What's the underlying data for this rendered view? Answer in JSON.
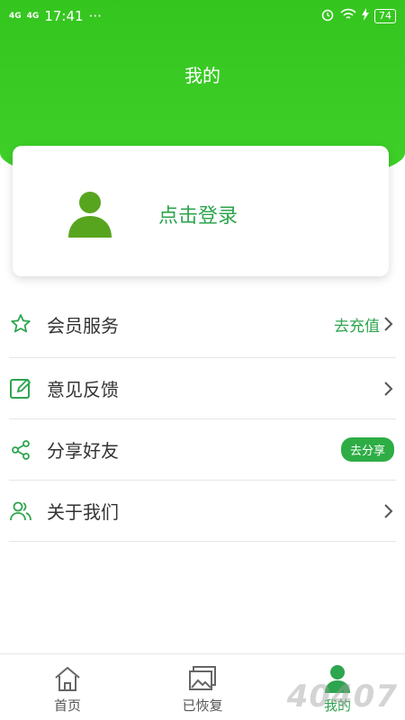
{
  "status_bar": {
    "signal1": "4G",
    "signal2": "4G",
    "time": "17:41",
    "more": "···",
    "battery": "74"
  },
  "header": {
    "title": "我的"
  },
  "login_card": {
    "login_text": "点击登录"
  },
  "menu": {
    "items": [
      {
        "label": "会员服务",
        "right_text": "去充值"
      },
      {
        "label": "意见反馈"
      },
      {
        "label": "分享好友",
        "badge": "去分享"
      },
      {
        "label": "关于我们"
      }
    ]
  },
  "tabbar": {
    "tabs": [
      {
        "label": "首页"
      },
      {
        "label": "已恢复"
      },
      {
        "label": "我的"
      }
    ]
  },
  "watermark": "40407",
  "colors": {
    "header_green": "#3fd12a",
    "accent_green": "#2da54e",
    "avatar_green": "#57a51f"
  }
}
